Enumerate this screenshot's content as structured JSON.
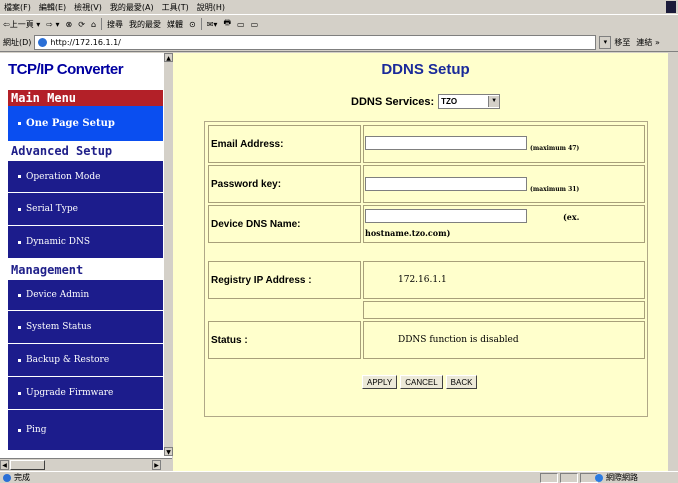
{
  "browser": {
    "menu": [
      "檔案(F)",
      "編輯(E)",
      "檢視(V)",
      "我的最愛(A)",
      "工具(T)",
      "說明(H)"
    ],
    "toolbar": [
      "⇦上一頁 ▾",
      "⇨ ▾",
      "⊗",
      "⟳",
      "⌂",
      "搜尋",
      "我的最愛",
      "媒體",
      "⊙",
      "✉▾",
      "🖶",
      "▭",
      "▭"
    ],
    "address_label": "網址(D)",
    "url": "http://172.16.1.1/",
    "go_label": "移至",
    "links_label": "連結 »",
    "status_text": "完成",
    "zone_text": "網際網路"
  },
  "sidebar": {
    "title": "TCP/IP Converter",
    "main_menu_header": "Main Menu",
    "advanced_header": "Advanced Setup",
    "management_header": "Management",
    "items": [
      {
        "label": "One Page Setup"
      },
      {
        "label": "Operation Mode"
      },
      {
        "label": "Serial Type"
      },
      {
        "label": "Dynamic DNS"
      },
      {
        "label": "Device Admin"
      },
      {
        "label": "System Status"
      },
      {
        "label": "Backup & Restore"
      },
      {
        "label": "Upgrade Firmware"
      },
      {
        "label": "Ping"
      }
    ]
  },
  "main": {
    "title": "DDNS Setup",
    "services_label": "DDNS Services:",
    "services_value": "TZO",
    "email_label": "Email Address:",
    "email_hint": "(maximum 47)",
    "password_label": "Password key:",
    "password_hint": "(maximum 31)",
    "dns_label": "Device DNS Name:",
    "dns_hint_1": "(ex.",
    "dns_hint_2": "hostname.tzo.com)",
    "registry_label": "Registry IP Address :",
    "registry_value": "172.16.1.1",
    "status_label": "Status :",
    "status_value": "DDNS function is disabled",
    "buttons": {
      "apply": "APPLY",
      "cancel": "CANCEL",
      "back": "BACK"
    }
  },
  "colors": {
    "nav_blue": "#1c1c8c",
    "active_blue": "#0a4ef0",
    "header_red": "#b32028",
    "content_bg": "#ffffcc",
    "title_blue": "#1a2a9a"
  }
}
